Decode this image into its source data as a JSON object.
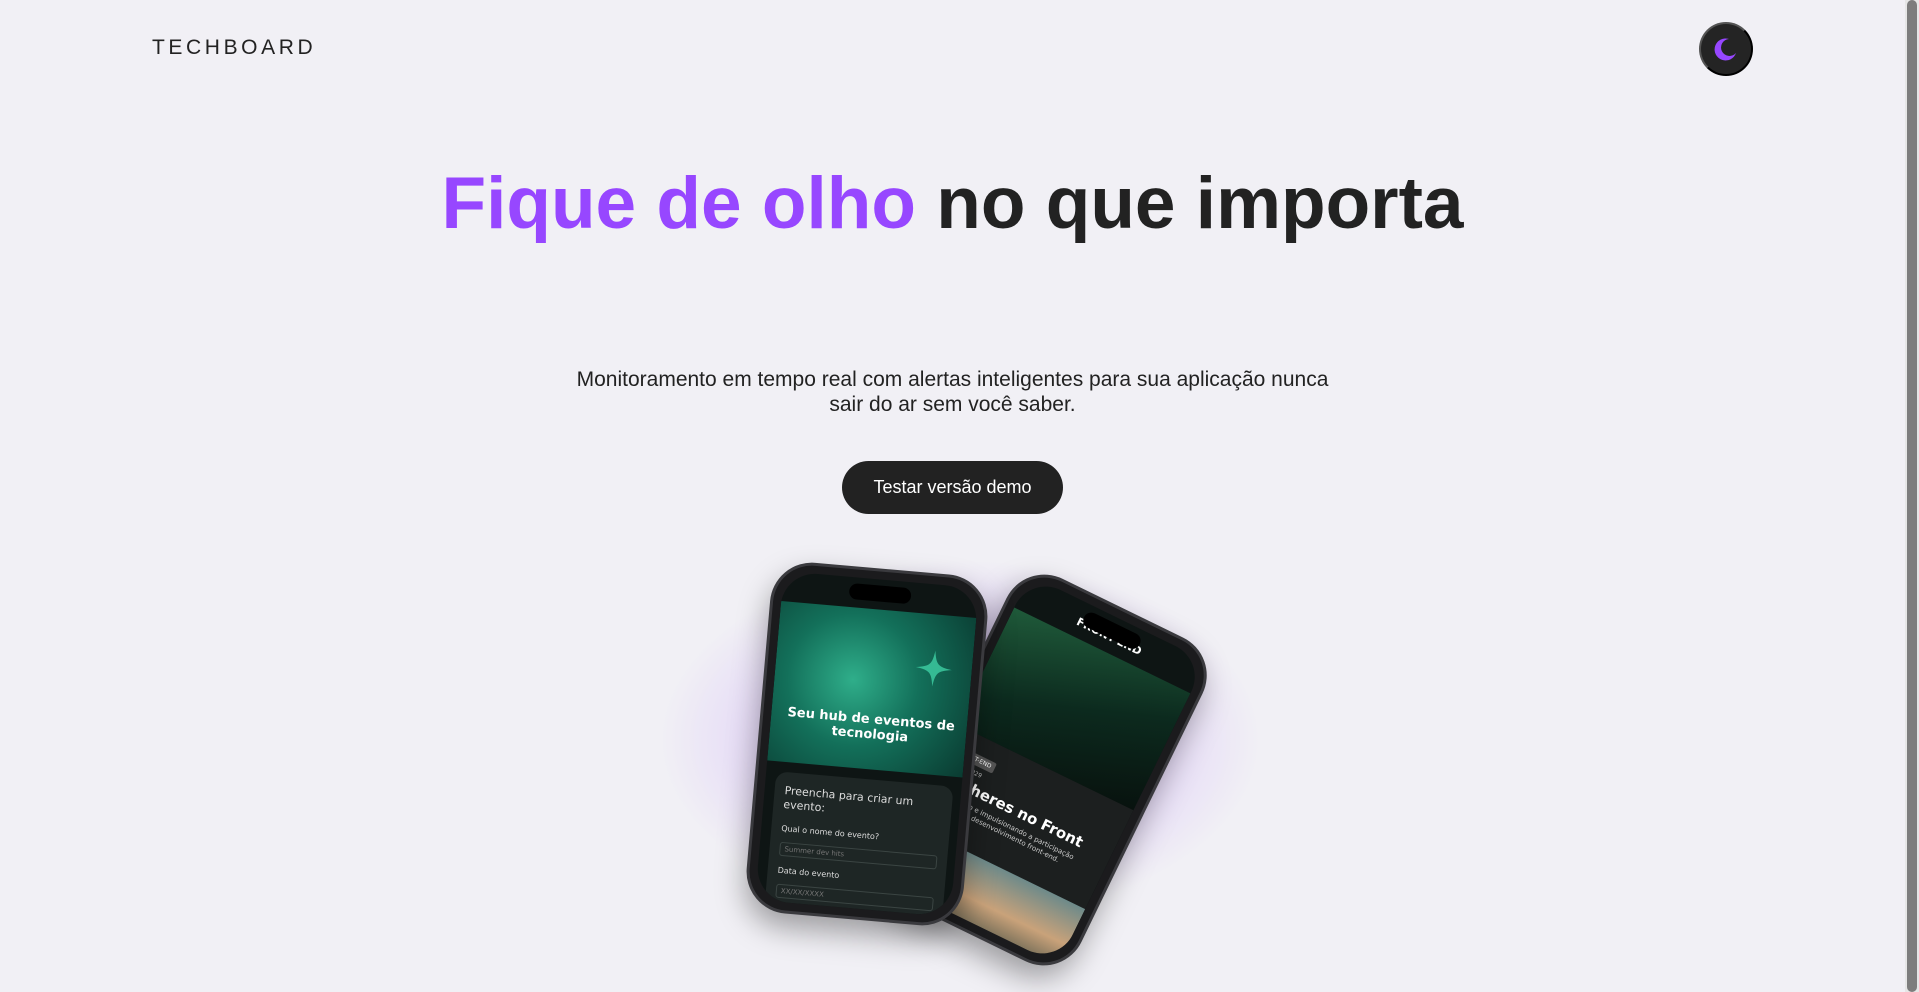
{
  "header": {
    "logo": "TECHBOARD",
    "theme_toggle_icon": "moon-icon"
  },
  "hero": {
    "title_accent": "Fique de olho",
    "title_rest": "no que importa",
    "subtitle": "Monitoramento em tempo real com alertas inteligentes para sua aplicação nunca sair do ar sem você saber.",
    "cta_label": "Testar versão demo"
  },
  "mockup_left": {
    "hero_text": "Seu hub de eventos de tecnologia",
    "form_title": "Preencha para criar um evento:",
    "field1_label": "Qual o nome do evento?",
    "field1_placeholder": "Summer dev hits",
    "field2_label": "Data do evento",
    "field2_placeholder": "XX/XX/XXXX"
  },
  "mockup_right": {
    "header": "FRONT-END",
    "tag": "FRONT-END",
    "date": "20/05/2029",
    "title": "Mulheres no Front",
    "description": "Valorizando e impulsionando a participação feminina no desenvolvimento front-end."
  },
  "colors": {
    "accent": "#9747ff",
    "background": "#f1f0f5",
    "dark": "#222222"
  }
}
